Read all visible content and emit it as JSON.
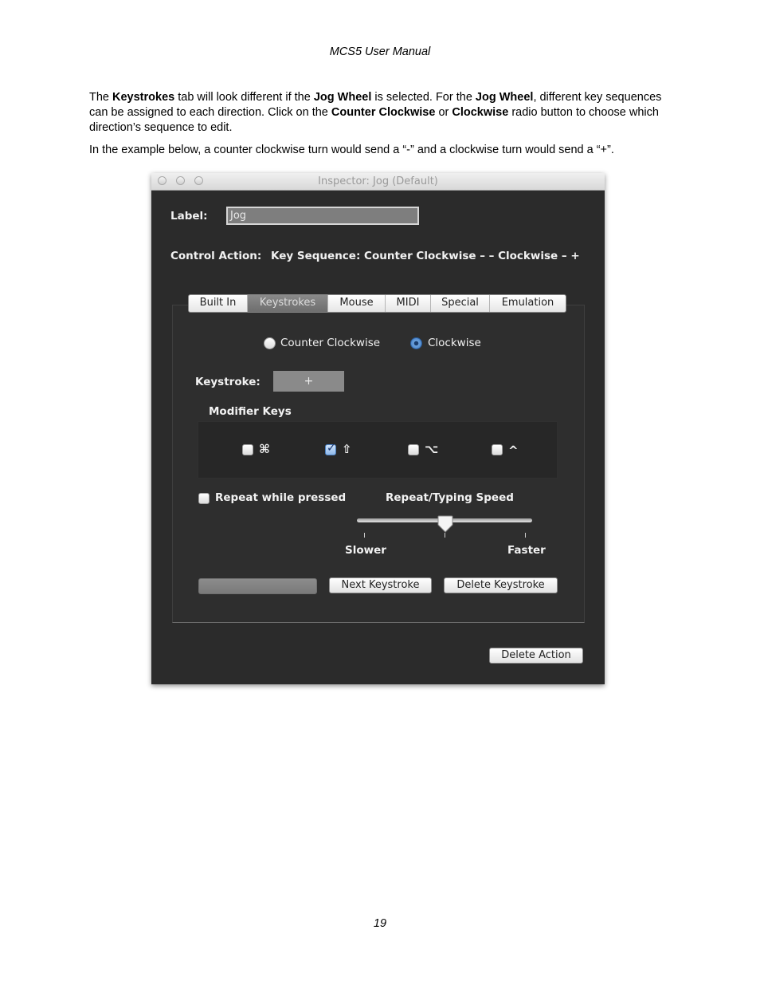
{
  "document": {
    "header": "MCS5 User Manual",
    "para1": {
      "t1": "The ",
      "b1": "Keystrokes",
      "t2": " tab will look different if the ",
      "b2": "Jog Wheel",
      "t3": " is selected. For the ",
      "b3": "Jog Wheel",
      "t4": ", different key sequences can be assigned to each direction. Click on the ",
      "b4": "Counter Clockwise",
      "t5": " or ",
      "b5": "Clockwise",
      "t6": " radio button to choose which direction’s sequence to edit."
    },
    "para2": "In the example below, a counter clockwise turn would send a “-” and a clockwise turn would send a “+”.",
    "page_number": "19"
  },
  "window": {
    "title": "Inspector: Jog (Default)",
    "label_caption": "Label:",
    "label_value": "Jog",
    "control_action_caption": "Control Action:",
    "control_action_value": "Key Sequence:  Counter Clockwise – –   Clockwise – +",
    "tabs": [
      "Built In",
      "Keystrokes",
      "Mouse",
      "MIDI",
      "Special",
      "Emulation"
    ],
    "active_tab": "Keystrokes",
    "direction": {
      "ccw_label": "Counter Clockwise",
      "cw_label": "Clockwise",
      "selected": "Clockwise"
    },
    "keystroke_caption": "Keystroke:",
    "keystroke_value": "+",
    "modifier_keys_caption": "Modifier Keys",
    "modifiers": [
      {
        "icon": "command-icon",
        "glyph": "⌘",
        "checked": false
      },
      {
        "icon": "shift-icon",
        "glyph": "⇧",
        "checked": true
      },
      {
        "icon": "option-icon",
        "glyph": "⌥",
        "checked": false
      },
      {
        "icon": "control-icon",
        "glyph": "^",
        "checked": false
      }
    ],
    "repeat_label": "Repeat while pressed",
    "repeat_checked": false,
    "speed_caption": "Repeat/Typing Speed",
    "speed_level": 0.5,
    "slower_label": "Slower",
    "faster_label": "Faster",
    "next_keystroke_label": "Next Keystroke",
    "delete_keystroke_label": "Delete Keystroke",
    "delete_action_label": "Delete Action"
  }
}
